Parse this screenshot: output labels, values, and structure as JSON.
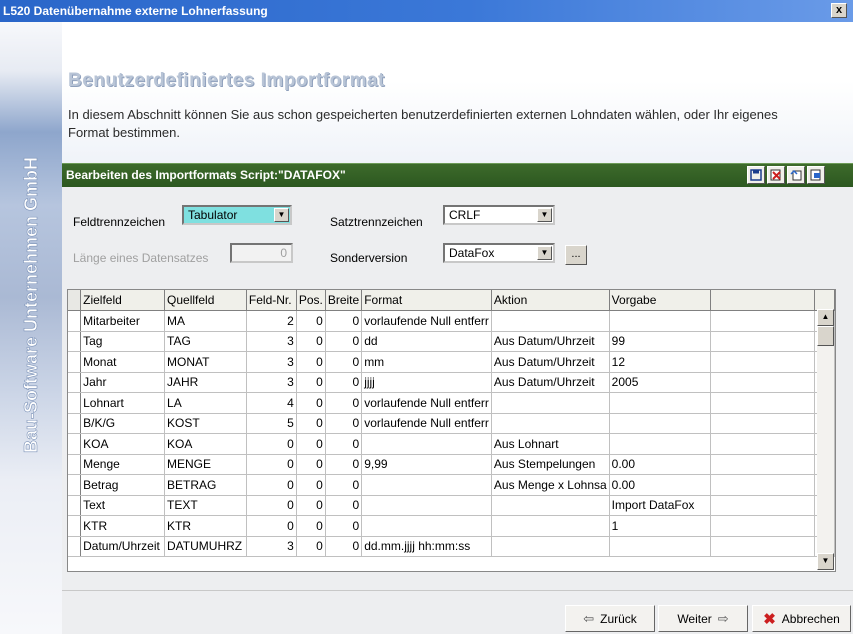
{
  "window": {
    "title": "L520 Datenübernahme externe Lohnerfassung",
    "close_label": "x"
  },
  "sidebar": {
    "brand": "Bau-Software Unternehmen GmbH"
  },
  "header": {
    "title": "Benutzerdefiniertes Importformat",
    "description": "In diesem Abschnitt können Sie aus schon gespeicherten benutzerdefinierten externen Lohndaten wählen, oder Ihr eigenes Format bestimmen."
  },
  "section": {
    "title": "Bearbeiten des Importformats Script:\"DATAFOX\"",
    "toolbar_icons": [
      "save-icon",
      "delete-icon",
      "new-icon",
      "export-icon"
    ]
  },
  "form": {
    "feldtrennzeichen_label": "Feldtrennzeichen",
    "feldtrennzeichen_value": "Tabulator",
    "satztrennzeichen_label": "Satztrennzeichen",
    "satztrennzeichen_value": "CRLF",
    "laenge_label": "Länge eines Datensatzes",
    "laenge_value": "0",
    "sonderversion_label": "Sonderversion",
    "sonderversion_value": "DataFox",
    "more_button": "..."
  },
  "table": {
    "columns": [
      "Zielfeld",
      "Quellfeld",
      "Feld-Nr.",
      "Pos.",
      "Breite",
      "Format",
      "Aktion",
      "Vorgabe"
    ],
    "rows": [
      {
        "zielfeld": "Mitarbeiter",
        "quellfeld": "MA",
        "feldnr": "2",
        "pos": "0",
        "breite": "0",
        "format": "vorlaufende Null entferr",
        "aktion": "",
        "vorgabe": ""
      },
      {
        "zielfeld": "Tag",
        "quellfeld": "TAG",
        "feldnr": "3",
        "pos": "0",
        "breite": "0",
        "format": "dd",
        "aktion": "Aus Datum/Uhrzeit",
        "vorgabe": "99"
      },
      {
        "zielfeld": "Monat",
        "quellfeld": "MONAT",
        "feldnr": "3",
        "pos": "0",
        "breite": "0",
        "format": "mm",
        "aktion": "Aus Datum/Uhrzeit",
        "vorgabe": "12"
      },
      {
        "zielfeld": "Jahr",
        "quellfeld": "JAHR",
        "feldnr": "3",
        "pos": "0",
        "breite": "0",
        "format": "jjjj",
        "aktion": "Aus Datum/Uhrzeit",
        "vorgabe": "2005"
      },
      {
        "zielfeld": "Lohnart",
        "quellfeld": "LA",
        "feldnr": "4",
        "pos": "0",
        "breite": "0",
        "format": "vorlaufende Null entferr",
        "aktion": "",
        "vorgabe": ""
      },
      {
        "zielfeld": "B/K/G",
        "quellfeld": "KOST",
        "feldnr": "5",
        "pos": "0",
        "breite": "0",
        "format": "vorlaufende Null entferr",
        "aktion": "",
        "vorgabe": ""
      },
      {
        "zielfeld": "KOA",
        "quellfeld": "KOA",
        "feldnr": "0",
        "pos": "0",
        "breite": "0",
        "format": "",
        "aktion": "Aus Lohnart",
        "vorgabe": ""
      },
      {
        "zielfeld": "Menge",
        "quellfeld": "MENGE",
        "feldnr": "0",
        "pos": "0",
        "breite": "0",
        "format": "9,99",
        "aktion": "Aus Stempelungen",
        "vorgabe": "0.00"
      },
      {
        "zielfeld": "Betrag",
        "quellfeld": "BETRAG",
        "feldnr": "0",
        "pos": "0",
        "breite": "0",
        "format": "",
        "aktion": "Aus Menge x Lohnsa",
        "vorgabe": "0.00"
      },
      {
        "zielfeld": "Text",
        "quellfeld": "TEXT",
        "feldnr": "0",
        "pos": "0",
        "breite": "0",
        "format": "",
        "aktion": "",
        "vorgabe": "Import DataFox"
      },
      {
        "zielfeld": "KTR",
        "quellfeld": "KTR",
        "feldnr": "0",
        "pos": "0",
        "breite": "0",
        "format": "",
        "aktion": "",
        "vorgabe": "1"
      },
      {
        "zielfeld": "Datum/Uhrzeit",
        "quellfeld": "DATUMUHRZ",
        "feldnr": "3",
        "pos": "0",
        "breite": "0",
        "format": "dd.mm.jjjj hh:mm:ss",
        "aktion": "",
        "vorgabe": ""
      }
    ]
  },
  "footer": {
    "back_label": "Zurück",
    "next_label": "Weiter",
    "cancel_label": "Abbrechen"
  }
}
